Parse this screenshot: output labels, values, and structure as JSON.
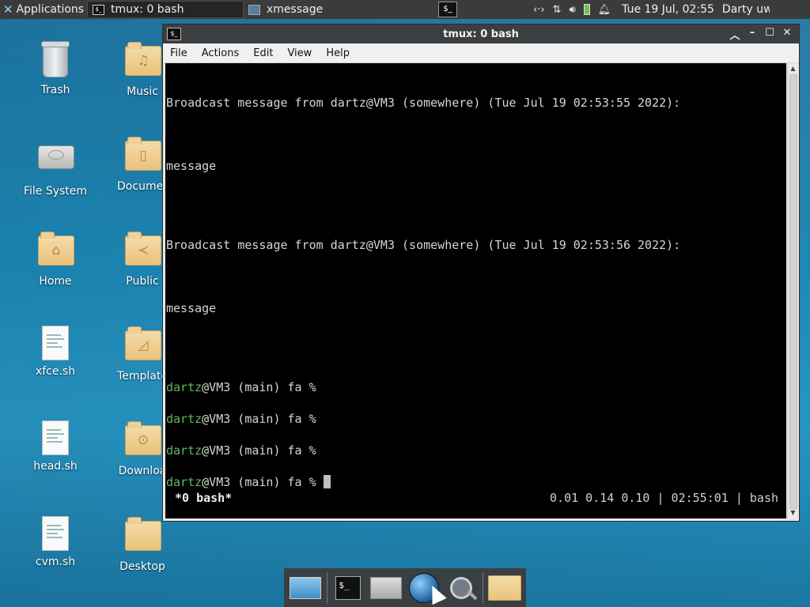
{
  "top_panel": {
    "applications_label": "Applications",
    "tasks": [
      {
        "label": "tmux: 0 bash"
      },
      {
        "label": "xmessage"
      }
    ],
    "clock": "Tue 19 Jul, 02:55",
    "user": "Darty uwu"
  },
  "desktop": {
    "icons": [
      {
        "label": "Trash",
        "icon": "trash-icon"
      },
      {
        "label": "Music",
        "icon": "music-folder-icon"
      },
      {
        "label": "File System",
        "icon": "drive-icon"
      },
      {
        "label": "Documer",
        "icon": "documents-folder-icon"
      },
      {
        "label": "Home",
        "icon": "home-folder-icon"
      },
      {
        "label": "Public",
        "icon": "public-folder-icon"
      },
      {
        "label": "xfce.sh",
        "icon": "script-file-icon"
      },
      {
        "label": "Template",
        "icon": "templates-folder-icon"
      },
      {
        "label": "head.sh",
        "icon": "script-file-icon"
      },
      {
        "label": "Downloa",
        "icon": "downloads-folder-icon"
      },
      {
        "label": "cvm.sh",
        "icon": "script-file-icon"
      },
      {
        "label": "Desktop",
        "icon": "folder-icon"
      }
    ]
  },
  "window": {
    "title": "tmux: 0 bash",
    "menu": [
      "File",
      "Actions",
      "Edit",
      "View",
      "Help"
    ]
  },
  "terminal": {
    "broadcast_1": "Broadcast message from dartz@VM3 (somewhere) (Tue Jul 19 02:53:55 2022):",
    "message_1": "message",
    "broadcast_2": "Broadcast message from dartz@VM3 (somewhere) (Tue Jul 19 02:53:56 2022):",
    "message_2": "message",
    "prompt_user": "dartz",
    "prompt_rest": "@VM3 (main) fa % ",
    "status_left": "*0 bash*",
    "status_right": "0.01 0.14 0.10 | 02:55:01 | bash"
  },
  "dock": {
    "items": [
      "desktop-icon",
      "terminal-icon",
      "home-icon",
      "web-browser-icon",
      "search-icon",
      "folder-icon"
    ]
  }
}
